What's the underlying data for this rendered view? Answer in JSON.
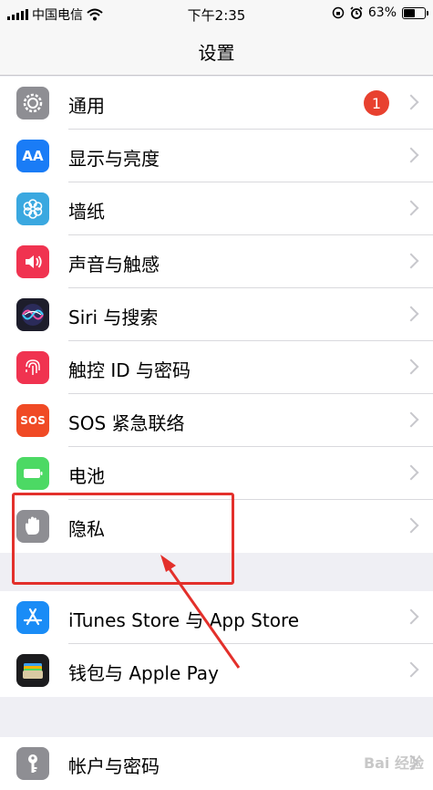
{
  "status_bar": {
    "carrier": "中国电信",
    "time": "下午2:35",
    "battery": "63%",
    "battery_level": 0.63
  },
  "nav": {
    "title": "设置"
  },
  "groups": [
    {
      "items": [
        {
          "label": "通用",
          "icon": "gear-icon",
          "badge": "1"
        },
        {
          "label": "显示与亮度",
          "icon": "display-brightness-icon",
          "icon_text": "AA"
        },
        {
          "label": "墙纸",
          "icon": "wallpaper-flower-icon"
        },
        {
          "label": "声音与触感",
          "icon": "speaker-icon"
        },
        {
          "label": "Siri 与搜索",
          "icon": "siri-icon"
        },
        {
          "label": "触控 ID 与密码",
          "icon": "fingerprint-icon"
        },
        {
          "label": "SOS 紧急联络",
          "icon": "sos-icon",
          "icon_text": "SOS"
        },
        {
          "label": "电池",
          "icon": "battery-icon"
        },
        {
          "label": "隐私",
          "icon": "hand-icon"
        }
      ]
    },
    {
      "items": [
        {
          "label": "iTunes Store 与 App Store",
          "icon": "app-store-icon"
        },
        {
          "label": "钱包与 Apple Pay",
          "icon": "wallet-icon"
        }
      ]
    },
    {
      "items": [
        {
          "label": "帐户与密码",
          "icon": "key-icon"
        }
      ]
    }
  ],
  "colors": {
    "general": "#8e8e93",
    "display": "#1a7cf6",
    "wallpaper": "#3aa8e0",
    "sounds": "#f03350",
    "siri": "#1d1d2b",
    "touchid": "#f03350",
    "sos": "#f04a25",
    "battery": "#4cd964",
    "privacy": "#8e8e93",
    "appstore": "#1a8cf6",
    "wallet": "#1c1c1e",
    "accounts": "#8e8e93",
    "badge": "#e8412f",
    "annotation": "#e3302b"
  },
  "watermark": "Bai 经验"
}
